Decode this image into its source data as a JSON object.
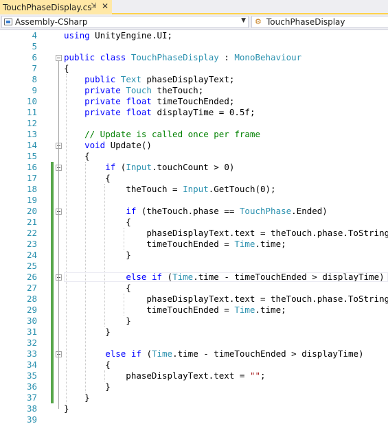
{
  "tab": {
    "title": "TouchPhaseDisplay.cs",
    "pin_icon": "pin-icon",
    "close_icon": "close-icon"
  },
  "nav": {
    "project": "Assembly-CSharp",
    "member": "TouchPhaseDisplay"
  },
  "lines": [
    {
      "n": "4",
      "html": "<span class=\"kw\">using</span> UnityEngine.UI;"
    },
    {
      "n": "5",
      "html": ""
    },
    {
      "n": "6",
      "html": "<span class=\"kw\">public</span> <span class=\"kw\">class</span> <span class=\"ty\">TouchPhaseDisplay</span> : <span class=\"ty\">MonoBehaviour</span>"
    },
    {
      "n": "7",
      "html": "{"
    },
    {
      "n": "8",
      "html": "    <span class=\"kw\">public</span> <span class=\"ty\">Text</span> phaseDisplayText;"
    },
    {
      "n": "9",
      "html": "    <span class=\"kw\">private</span> <span class=\"ty\">Touch</span> theTouch;"
    },
    {
      "n": "10",
      "html": "    <span class=\"kw\">private</span> <span class=\"kw\">float</span> timeTouchEnded;"
    },
    {
      "n": "11",
      "html": "    <span class=\"kw\">private</span> <span class=\"kw\">float</span> displayTime = 0.5f;"
    },
    {
      "n": "12",
      "html": ""
    },
    {
      "n": "13",
      "html": "    <span class=\"cm\">// Update is called once per frame</span>"
    },
    {
      "n": "14",
      "html": "    <span class=\"kw\">void</span> Update()"
    },
    {
      "n": "15",
      "html": "    {"
    },
    {
      "n": "16",
      "html": "        <span class=\"kw\">if</span> (<span class=\"ty\">Input</span>.touchCount &gt; 0)"
    },
    {
      "n": "17",
      "html": "        {"
    },
    {
      "n": "18",
      "html": "            theTouch = <span class=\"ty\">Input</span>.GetTouch(0);"
    },
    {
      "n": "19",
      "html": ""
    },
    {
      "n": "20",
      "html": "            <span class=\"kw\">if</span> (theTouch.phase == <span class=\"ty\">TouchPhase</span>.Ended)"
    },
    {
      "n": "21",
      "html": "            {"
    },
    {
      "n": "22",
      "html": "                phaseDisplayText.text = theTouch.phase.ToString();"
    },
    {
      "n": "23",
      "html": "                timeTouchEnded = <span class=\"ty\">Time</span>.time;"
    },
    {
      "n": "24",
      "html": "            }"
    },
    {
      "n": "25",
      "html": ""
    },
    {
      "n": "26",
      "html": "            <span class=\"kw\">else</span> <span class=\"kw\">if</span> (<span class=\"ty\">Time</span>.time - timeTouchEnded &gt; displayTime)"
    },
    {
      "n": "27",
      "html": "            {"
    },
    {
      "n": "28",
      "html": "                phaseDisplayText.text = theTouch.phase.ToString();"
    },
    {
      "n": "29",
      "html": "                timeTouchEnded = <span class=\"ty\">Time</span>.time;"
    },
    {
      "n": "30",
      "html": "            }"
    },
    {
      "n": "31",
      "html": "        }"
    },
    {
      "n": "32",
      "html": ""
    },
    {
      "n": "33",
      "html": "        <span class=\"kw\">else</span> <span class=\"kw\">if</span> (<span class=\"ty\">Time</span>.time - timeTouchEnded &gt; displayTime)"
    },
    {
      "n": "34",
      "html": "        {"
    },
    {
      "n": "35",
      "html": "            phaseDisplayText.text = <span class=\"st\">\"\"</span>;"
    },
    {
      "n": "36",
      "html": "        }"
    },
    {
      "n": "37",
      "html": "    }"
    },
    {
      "n": "38",
      "html": "}"
    },
    {
      "n": "39",
      "html": ""
    }
  ]
}
